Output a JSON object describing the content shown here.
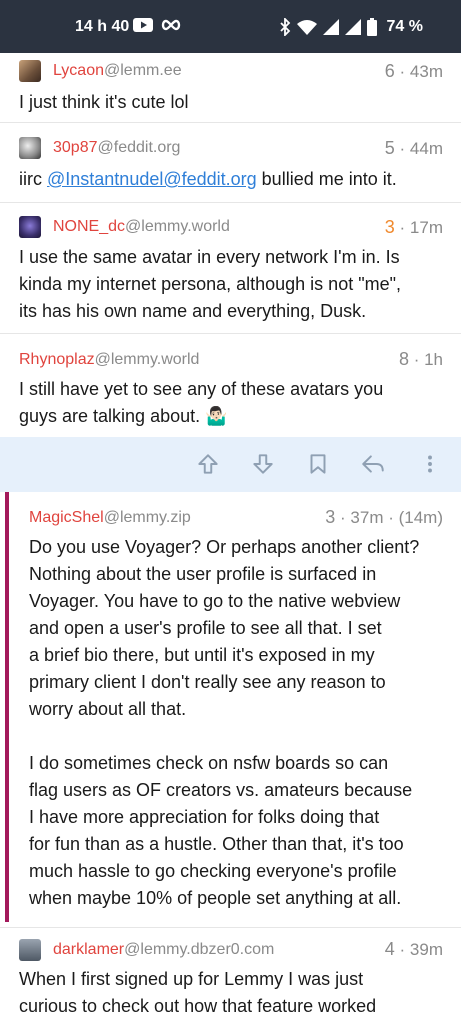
{
  "status_bar": {
    "time": "14 h 40",
    "battery": "74 %"
  },
  "comments": [
    {
      "user": "Lycaon",
      "instance": "@lemm.ee",
      "score": "6",
      "age": "· 43m",
      "text": "I just think it's cute lol"
    },
    {
      "user": "30p87",
      "instance": "@feddit.org",
      "score": "5",
      "age": "· 44m",
      "prefix": "iirc ",
      "mention": "@Instantnudel@feddit.org",
      "suffix": " bullied me into it."
    },
    {
      "user": "NONE_dc",
      "instance": "@lemmy.world",
      "score": "3",
      "age": "· 17m",
      "lines": [
        "I use the same avatar in every network I'm in. Is",
        "kinda my internet persona, although is not \"me\",",
        "its has his own name and everything, Dusk."
      ]
    },
    {
      "user": "Rhynoplaz",
      "instance": "@lemmy.world",
      "score": "8",
      "age": "· 1h",
      "lines": [
        "I still have yet to see any of these avatars you",
        "guys are talking about. 🤷🏻‍♂️"
      ]
    }
  ],
  "actions": {
    "upvote": "upvote",
    "downvote": "downvote",
    "save": "bookmark",
    "reply": "reply",
    "more": "more"
  },
  "reply": {
    "user": "MagicShel",
    "instance": "@lemmy.zip",
    "score": "3",
    "age": "· 37m · (14m)",
    "lines": [
      "Do you use Voyager? Or perhaps another client?",
      "Nothing about the user profile is surfaced in",
      "Voyager. You have to go to the native webview",
      "and open a user's profile to see all that. I set",
      "a brief bio there, but until it's exposed in my",
      "primary client I don't really see any reason to",
      "worry about all that.",
      "",
      "I do sometimes check on nsfw boards so can",
      "flag users as OF creators vs. amateurs because",
      "I have more appreciation for folks doing that",
      "for fun than as a hustle. Other than that, it's too",
      "much hassle to go checking everyone's profile",
      "when maybe 10% of people set anything at all."
    ]
  },
  "last": {
    "user": "darklamer",
    "instance": "@lemmy.dbzer0.com",
    "score": "4",
    "age": "· 39m",
    "lines": [
      "When I first signed up for Lemmy I was just",
      "curious to check out how that feature worked"
    ]
  },
  "colors": {
    "username": "#e0443e",
    "link": "#2f7fd8",
    "thread_bar": "#a3195b",
    "action_bg": "#e6f0fb",
    "status_bg": "#2b3340"
  }
}
